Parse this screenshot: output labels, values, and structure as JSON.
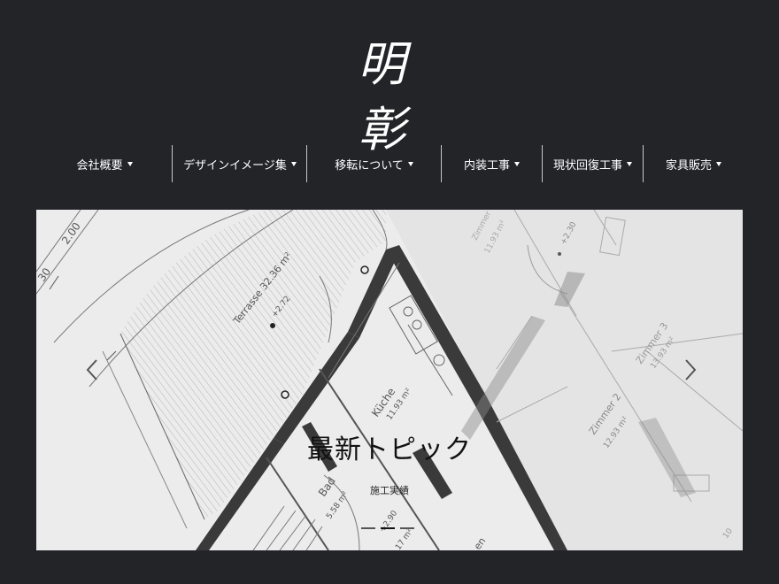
{
  "header": {
    "logo_text": "明彰"
  },
  "nav": {
    "items": [
      {
        "label": "会社概要"
      },
      {
        "label": "デザインイメージ集"
      },
      {
        "label": "移転について"
      },
      {
        "label": "内装工事"
      },
      {
        "label": "現状回復工事"
      },
      {
        "label": "家具販売"
      }
    ]
  },
  "hero": {
    "title": "最新トピック",
    "subtitle": "施工実績",
    "prev_icon": "chevron-left-icon",
    "next_icon": "chevron-right-icon",
    "slides_count": 3,
    "active_slide": 1
  },
  "floorplan_labels": {
    "terrasse": "Terrasse 32.36 m²",
    "kuche": "Küche",
    "kuche_area": "11.93 m²",
    "bad": "Bad",
    "bad_area": "5.58 m²",
    "zimmer2": "Zimmer 2",
    "zimmer2_area": "12.93 m²",
    "zimmer3": "Zimmer 3",
    "zimmer3_area": "13.93 m²",
    "zimmer1": "Zimmer",
    "zimmer1_area": "11.93 m²",
    "dim_200": "2.00",
    "dim_30": "30",
    "dim_272": "+2.72",
    "dim_290": "+2.90",
    "dim_17": "17 m²",
    "dim_230": "+2.30",
    "dim_10": "10",
    "en": "en"
  },
  "colors": {
    "page_bg": "#222428",
    "nav_text": "#ffffff",
    "divider": "#c8c8c8",
    "hero_bg": "#eeeeee",
    "wall": "#3a3a3a"
  }
}
